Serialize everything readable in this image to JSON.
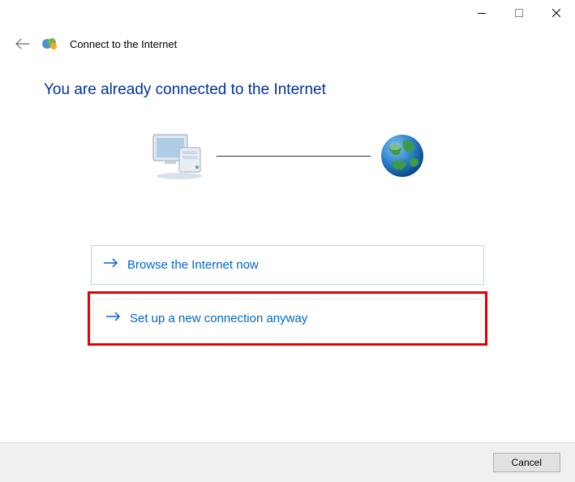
{
  "window": {
    "title": "Connect to the Internet"
  },
  "heading": "You are already connected to the Internet",
  "options": {
    "browse": "Browse the Internet now",
    "setup": "Set up a new connection anyway"
  },
  "footer": {
    "cancel": "Cancel"
  }
}
